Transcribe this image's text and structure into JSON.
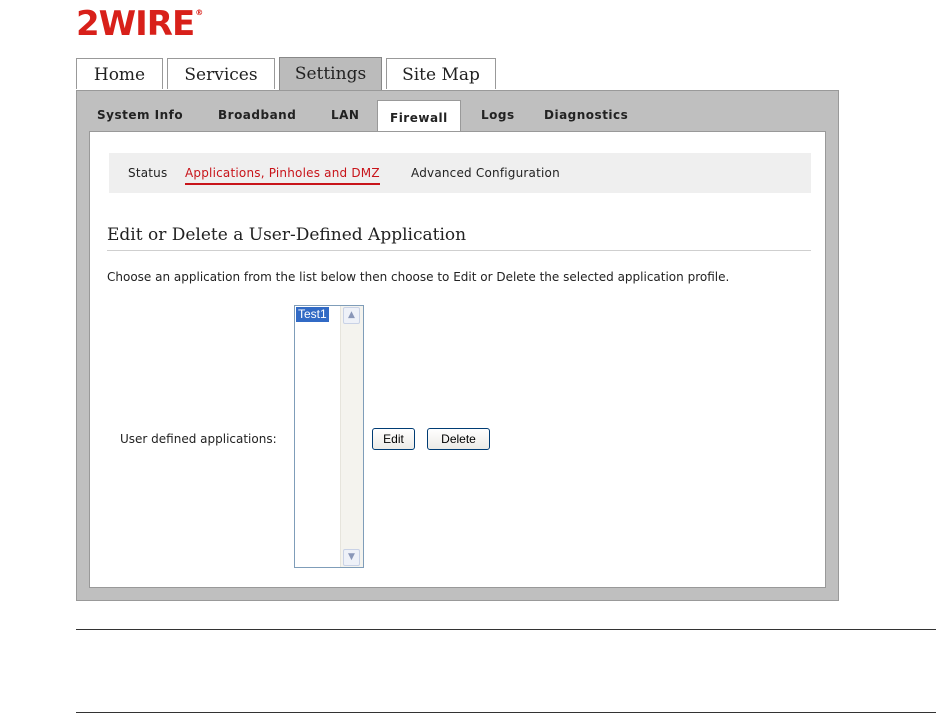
{
  "brand": {
    "logo_text": "2WIRE",
    "reg_mark": "®",
    "color": "#d8201a"
  },
  "top_tabs": [
    {
      "label": "Home"
    },
    {
      "label": "Services"
    },
    {
      "label": "Settings",
      "active": true
    },
    {
      "label": "Site Map"
    }
  ],
  "sub_tabs": [
    {
      "label": "System Info"
    },
    {
      "label": "Broadband"
    },
    {
      "label": "LAN"
    },
    {
      "label": "Firewall",
      "active": true
    },
    {
      "label": "Logs"
    },
    {
      "label": "Diagnostics"
    }
  ],
  "third_nav": [
    {
      "label": "Status"
    },
    {
      "label": "Applications, Pinholes and DMZ",
      "active": true
    },
    {
      "label": "Advanced Configuration"
    }
  ],
  "section": {
    "title": "Edit or Delete a User-Defined Application",
    "instructions": "Choose an application from the list below then choose to Edit or Delete the selected application profile."
  },
  "form": {
    "list_label": "User defined applications:",
    "applications": [
      "Test1"
    ],
    "selected": "Test1",
    "edit_label": "Edit",
    "delete_label": "Delete"
  },
  "colors": {
    "accent": "#c8141a",
    "selection": "#316ac5",
    "frame": "#bfbfbf"
  }
}
